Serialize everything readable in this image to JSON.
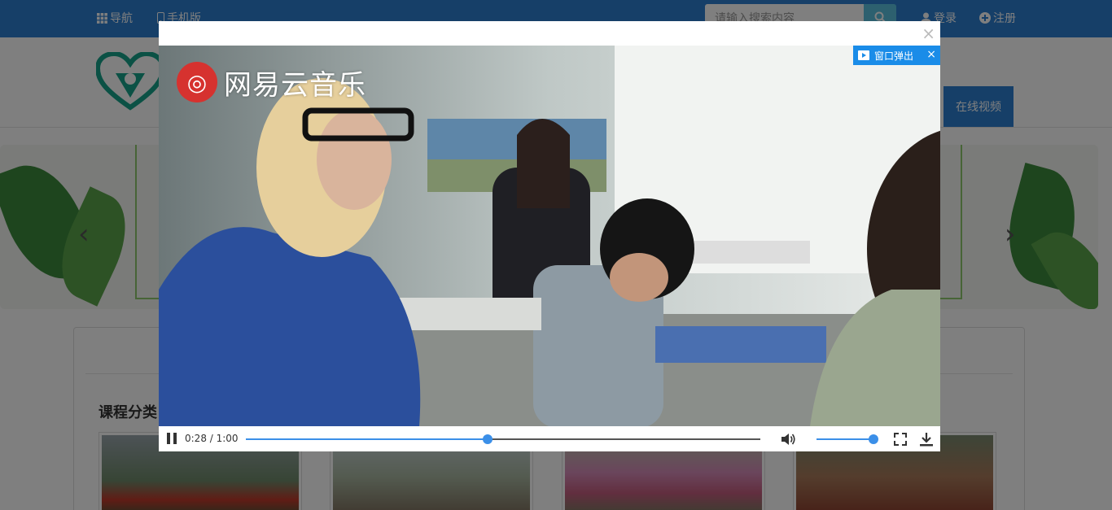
{
  "topbar": {
    "nav_label": "导航",
    "mobile_label": "手机版",
    "search_placeholder": "请输入搜索内容",
    "login_label": "登录",
    "register_label": "注册"
  },
  "header": {
    "video_link": "在线视频"
  },
  "courses": {
    "title": "课程分类"
  },
  "modal": {
    "close_symbol": "×",
    "popout_label": "窗口弹出",
    "popout_close": "×",
    "watermark_text": "网易云音乐",
    "player": {
      "time_display": "0:28 / 1:00",
      "progress": 0.47,
      "volume": 1.0
    }
  },
  "colors": {
    "brand": "#2d7fd1",
    "accent": "#1a8ce8",
    "progress": "#3b8fe8"
  },
  "icons": [
    "grid-icon",
    "mobile-icon",
    "search-icon",
    "user-icon",
    "plus-circle-icon",
    "play-icon",
    "pause-icon",
    "volume-icon",
    "fullscreen-icon",
    "download-icon"
  ]
}
